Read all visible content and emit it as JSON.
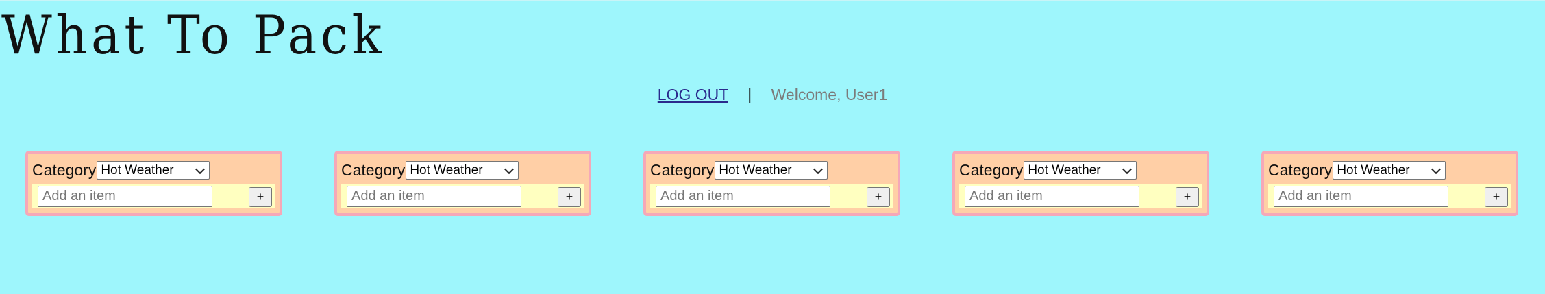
{
  "header": {
    "title": "What To Pack",
    "logout_label": "LOG OUT",
    "separator": "|",
    "welcome_text": "Welcome, User1"
  },
  "cards": [
    {
      "category_label": "Category",
      "category_value": "Hot Weather",
      "item_placeholder": "Add an item",
      "add_label": "+"
    },
    {
      "category_label": "Category",
      "category_value": "Hot Weather",
      "item_placeholder": "Add an item",
      "add_label": "+"
    },
    {
      "category_label": "Category",
      "category_value": "Hot Weather",
      "item_placeholder": "Add an item",
      "add_label": "+"
    },
    {
      "category_label": "Category",
      "category_value": "Hot Weather",
      "item_placeholder": "Add an item",
      "add_label": "+"
    },
    {
      "category_label": "Category",
      "category_value": "Hot Weather",
      "item_placeholder": "Add an item",
      "add_label": "+"
    }
  ],
  "colors": {
    "page_background": "#9ef6fc",
    "card_background": "#ffcfa6",
    "card_border": "#f5a8b8",
    "add_row_background": "#ffffc0",
    "link": "#2a2a8c",
    "welcome": "#7b7b7b"
  }
}
